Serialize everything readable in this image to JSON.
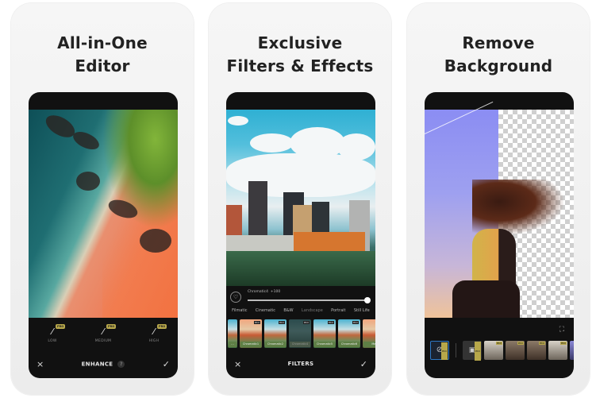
{
  "cards": [
    {
      "title_line1": "All-in-One",
      "title_line2": "Editor",
      "toolbar": {
        "cancel_icon": "×",
        "title": "ENHANCE",
        "help_icon": "?",
        "confirm_icon": "✓"
      },
      "enhance_options": [
        {
          "label": "LOW",
          "badge": "PRO",
          "icon": "magic-wand"
        },
        {
          "label": "MEDIUM",
          "badge": "PRO",
          "icon": "magic-wand"
        },
        {
          "label": "HIGH",
          "badge": "PRO",
          "icon": "magic-wand"
        }
      ]
    },
    {
      "title_line1": "Exclusive",
      "title_line2": "Filters & Effects",
      "toolbar": {
        "cancel_icon": "×",
        "title": "FILTERS",
        "confirm_icon": "✓"
      },
      "filter_panel": {
        "favorite_icon": "♡",
        "slider_label": "Chromatic4",
        "slider_value_text": "+100",
        "slider_value": 100,
        "slider_max": 100,
        "categories": [
          "Filmatic",
          "Cinematic",
          "B&W",
          "Landscape",
          "Portrait",
          "Still Life"
        ],
        "active_category": "Landscape",
        "thumbnails": [
          {
            "label": "Chromatic1",
            "badge": "PRO"
          },
          {
            "label": "Chromatic2",
            "badge": "PRO"
          },
          {
            "label": "Chromatic3",
            "badge": "PRO"
          },
          {
            "label": "Chromatic4",
            "badge": "PRO"
          },
          {
            "label": "Chromatic5",
            "badge": "PRO"
          },
          {
            "label": "Chromatic6",
            "badge": "PRO"
          },
          {
            "label": "Ma",
            "badge": ""
          }
        ]
      }
    },
    {
      "title_line1": "Remove",
      "title_line2": "Background",
      "bg_tools": {
        "fit_icon": "⛶",
        "none_icon": "⊘",
        "add_image_icon": "🖼",
        "badge": "PRO",
        "background_thumbnails": 6
      }
    }
  ]
}
